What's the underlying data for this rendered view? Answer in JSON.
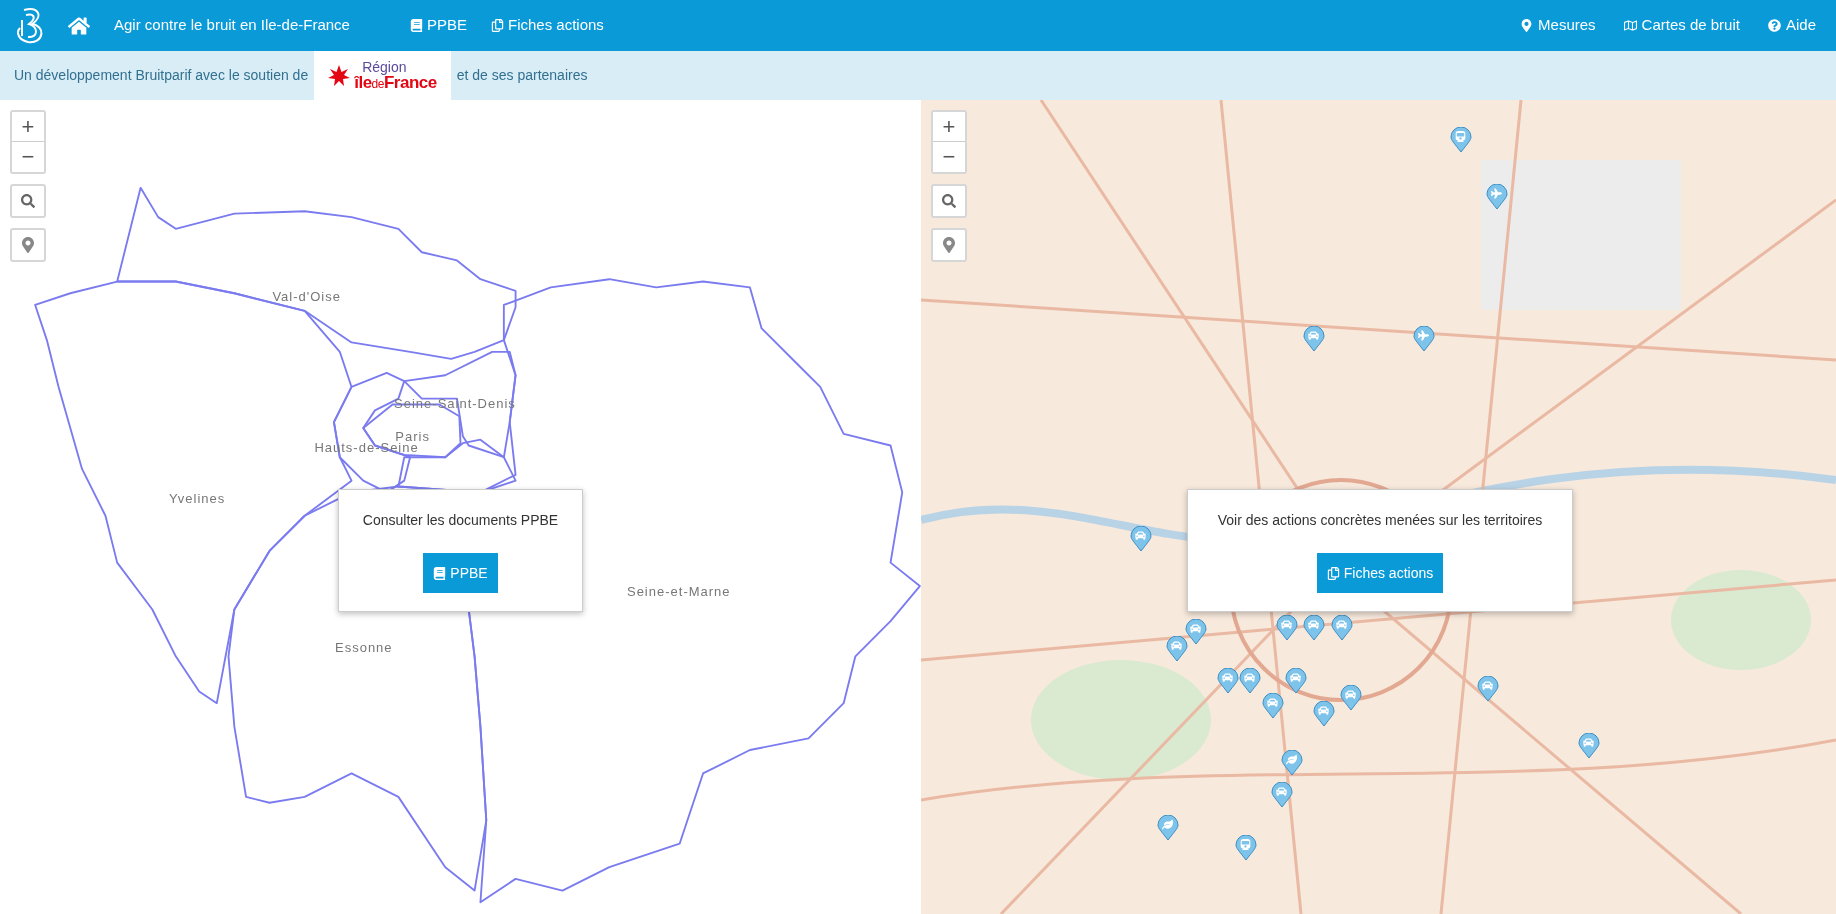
{
  "header": {
    "title": "Agir contre le bruit en Ile-de-France",
    "nav_left": [
      {
        "label": "PPBE"
      },
      {
        "label": "Fiches actions"
      }
    ],
    "nav_right": [
      {
        "label": "Mesures"
      },
      {
        "label": "Cartes de bruit"
      },
      {
        "label": "Aide"
      }
    ]
  },
  "banner": {
    "text_before": "Un développement Bruitparif avec le soutien de",
    "logo": {
      "line1": "Région",
      "part1": "île",
      "part2": "de",
      "part3": "France"
    },
    "text_after": "et de ses partenaires"
  },
  "left_map": {
    "zoom_in": "+",
    "zoom_out": "−",
    "departments": [
      "Val-d'Oise",
      "Yvelines",
      "Seine-Saint-Denis",
      "Paris",
      "Hauts-de-Seine",
      "Essonne",
      "Seine-et-Marne"
    ],
    "popup": {
      "text": "Consulter les documents PPBE",
      "button": "PPBE"
    }
  },
  "right_map": {
    "zoom_in": "+",
    "zoom_out": "−",
    "popup": {
      "text": "Voir des actions concrètes menées sur les territoires",
      "button": "Fiches actions"
    }
  }
}
